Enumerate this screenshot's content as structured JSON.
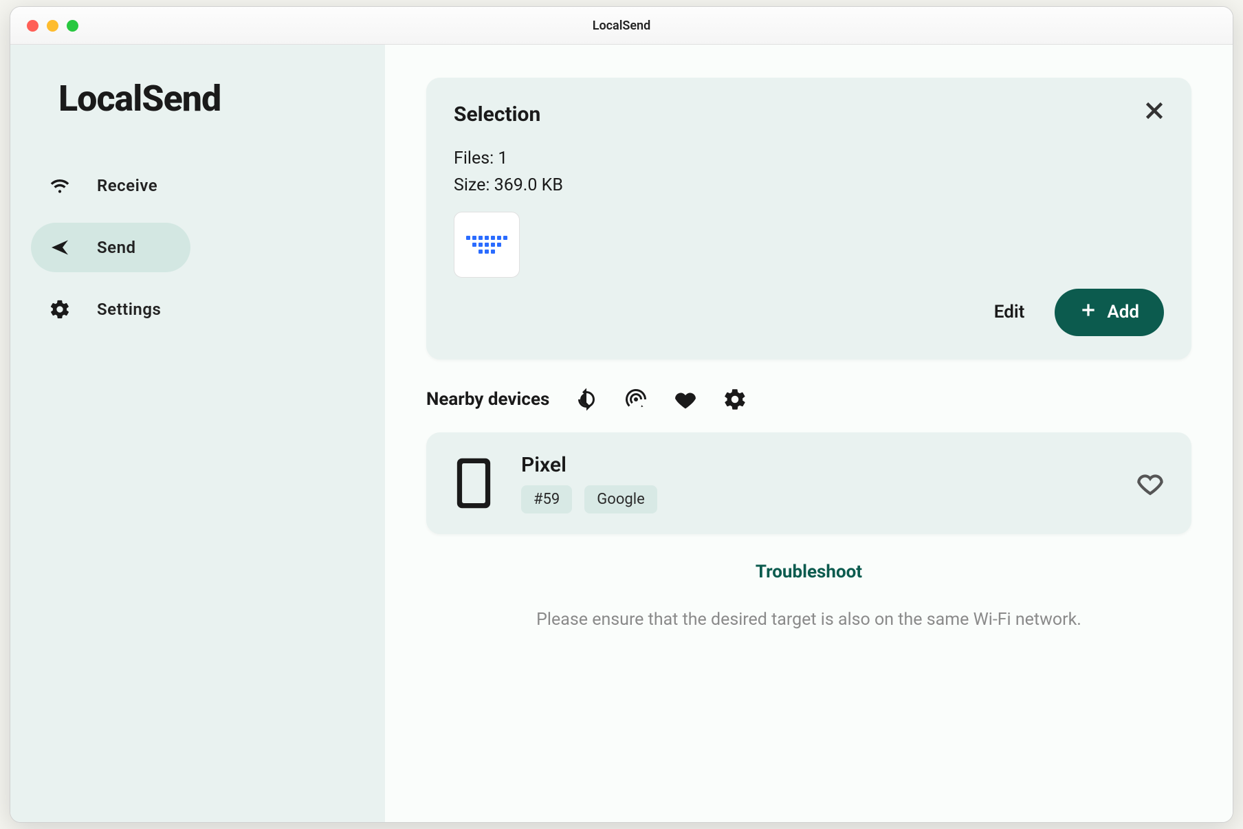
{
  "window": {
    "title": "LocalSend"
  },
  "sidebar": {
    "app_name": "LocalSend",
    "items": [
      {
        "label": "Receive"
      },
      {
        "label": "Send"
      },
      {
        "label": "Settings"
      }
    ]
  },
  "selection": {
    "title": "Selection",
    "files_label": "Files: 1",
    "size_label": "Size: 369.0 KB",
    "edit_label": "Edit",
    "add_label": "Add"
  },
  "nearby": {
    "label": "Nearby devices"
  },
  "devices": [
    {
      "name": "Pixel",
      "tag_id": "#59",
      "tag_vendor": "Google"
    }
  ],
  "footer": {
    "troubleshoot": "Troubleshoot",
    "hint": "Please ensure that the desired target is also on the same Wi-Fi network."
  }
}
